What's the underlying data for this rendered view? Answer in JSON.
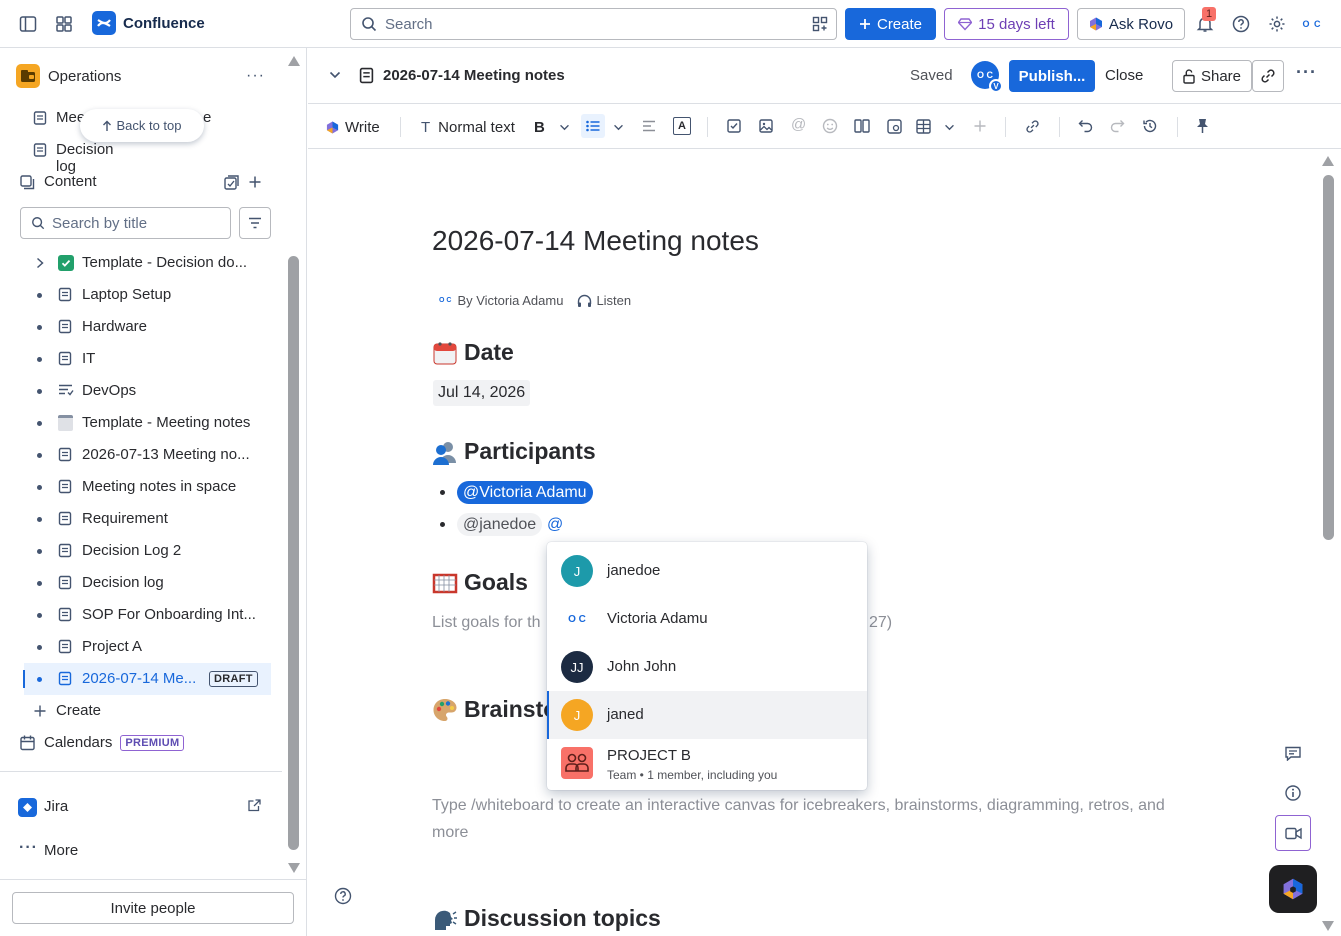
{
  "topnav": {
    "app_name": "Confluence",
    "search_placeholder": "Search",
    "create_label": "Create",
    "trial_label": "15 days left",
    "rovo_label": "Ask Rovo",
    "notification_count": "1"
  },
  "sidebar": {
    "space_name": "Operations",
    "pinned": [
      "Meeting notes in space",
      "Decision log"
    ],
    "pinned_visible_fragment": "Mee",
    "pinned_visible_tail": "e",
    "back_to_top": "Back to top",
    "content_label": "Content",
    "search_placeholder": "Search by title",
    "tree": [
      {
        "label": "Template - Decision do...",
        "icon": "check-emoji-icon"
      },
      {
        "label": "Laptop Setup",
        "icon": "page-icon"
      },
      {
        "label": "Hardware",
        "icon": "page-icon"
      },
      {
        "label": "IT",
        "icon": "page-icon"
      },
      {
        "label": "DevOps",
        "icon": "list-page-icon"
      },
      {
        "label": "Template - Meeting notes",
        "icon": "notepad-emoji-icon"
      },
      {
        "label": "2026-07-13 Meeting no...",
        "icon": "page-icon"
      },
      {
        "label": "Meeting notes in space",
        "icon": "page-icon"
      },
      {
        "label": "Requirement",
        "icon": "page-icon"
      },
      {
        "label": "Decision Log 2",
        "icon": "page-icon"
      },
      {
        "label": "Decision log",
        "icon": "page-icon"
      },
      {
        "label": "SOP For Onboarding Int...",
        "icon": "page-icon"
      },
      {
        "label": "Project A",
        "icon": "page-icon"
      },
      {
        "label": "2026-07-14 Me...",
        "icon": "page-icon",
        "badge": "DRAFT"
      }
    ],
    "create_label": "Create",
    "calendars_label": "Calendars",
    "premium_badge": "PREMIUM",
    "jira_label": "Jira",
    "more_label": "More",
    "invite_label": "Invite people"
  },
  "editor_header": {
    "title": "2026-07-14 Meeting notes",
    "status": "Saved",
    "avatar_initials": "O C",
    "avatar_badge": "V",
    "publish_label": "Publish...",
    "close_label": "Close",
    "share_label": "Share"
  },
  "toolbar": {
    "mode_label": "Write",
    "text_style": "Normal text",
    "bold": "B"
  },
  "document": {
    "title": "2026-07-14 Meeting notes",
    "byline": "By Victoria Adamu",
    "listen": "Listen",
    "date_heading": "Date",
    "date_value": "Jul 14, 2026",
    "participants_heading": "Participants",
    "participants": [
      "@Victoria Adamu",
      "@janedoe"
    ],
    "typing_trigger": "@",
    "goals_heading": "Goals",
    "goals_placeholder_left": "List goals for th",
    "goals_placeholder_right": "27)",
    "brainstorm_heading_fragment": "Brainsto",
    "whiteboard_placeholder": "Type /whiteboard to create an interactive canvas for icebreakers, brainstorms, diagramming, retros, and more",
    "discussion_heading": "Discussion topics"
  },
  "mention_menu": {
    "items": [
      {
        "name": "janedoe",
        "initials": "J",
        "color": "#1d9aaa"
      },
      {
        "name": "Victoria Adamu",
        "initials": "O C",
        "color": "#ffffff"
      },
      {
        "name": "John John",
        "initials": "JJ",
        "color": "#1c2b42"
      },
      {
        "name": "janed",
        "initials": "J",
        "color": "#f5a623"
      },
      {
        "name": "PROJECT B",
        "subtitle": "Team • 1 member, including you",
        "color": "#f87168"
      }
    ]
  },
  "colors": {
    "brand_blue": "#1868db",
    "trial_purple": "#8f63d2"
  }
}
